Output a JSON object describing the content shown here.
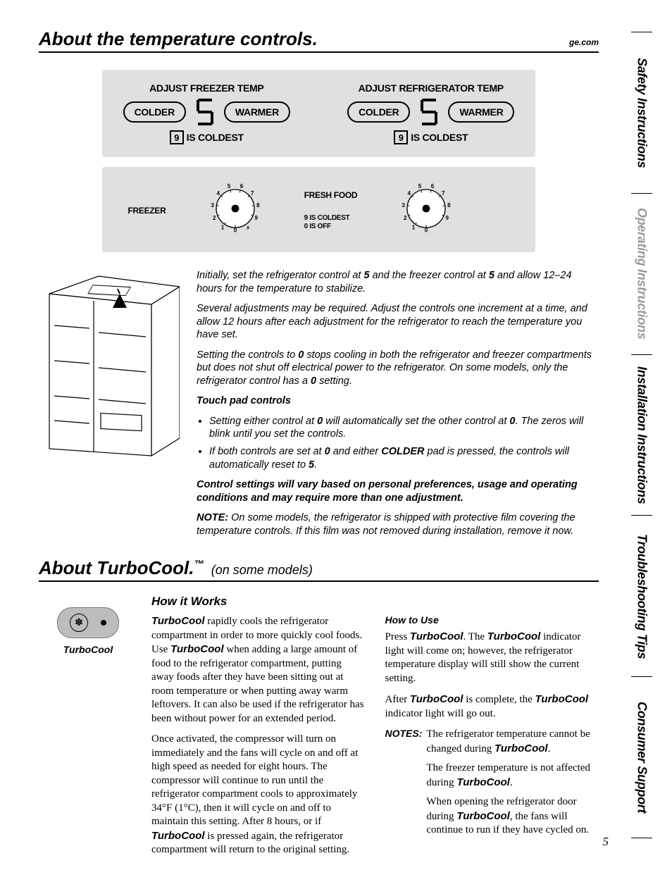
{
  "header": {
    "title": "About the temperature controls.",
    "site": "ge.com"
  },
  "sideTabs": {
    "t1": "Safety Instructions",
    "t2": "Operating Instructions",
    "t3": "Installation Instructions",
    "t4": "Troubleshooting Tips",
    "t5": "Consumer Support"
  },
  "digital": {
    "freezer": {
      "title": "ADJUST FREEZER TEMP",
      "colder": "COLDER",
      "warmer": "WARMER",
      "value": "5",
      "foot9": "9",
      "foot": "IS COLDEST"
    },
    "fridge": {
      "title": "ADJUST REFRIGERATOR TEMP",
      "colder": "COLDER",
      "warmer": "WARMER",
      "value": "5",
      "foot9": "9",
      "foot": "IS COLDEST"
    }
  },
  "dial": {
    "freezerLabel": "FREEZER",
    "freshLabel": "FRESH FOOD",
    "freshNote1": "9 IS COLDEST",
    "freshNote2": "0 IS OFF"
  },
  "instructions": {
    "p1a": "Initially, set the refrigerator control at ",
    "p1b": " and the freezer control at  ",
    "p1c": " and allow 12–24 hours for the temperature to stabilize.",
    "v5a": "5",
    "v5b": "5",
    "p2": "Several adjustments may be required. Adjust the controls one increment at a time, and allow 12 hours after each adjustment for the refrigerator to reach the temperature you have set.",
    "p3a": "Setting the controls to ",
    "p3b": " stops cooling in both the refrigerator and freezer compartments but does not shut off electrical power to the refrigerator. On some models, only the refrigerator control has a ",
    "p3c": " setting.",
    "v0a": "0",
    "v0b": "0",
    "touchTitle": "Touch pad controls",
    "li1a": "Setting either control at ",
    "li1b": " will automatically set the other control at ",
    "li1c": ". The zeros will blink until you set the controls.",
    "li1v0a": "0",
    "li1v0b": "0",
    "li2a": "If both controls are set at ",
    "li2b": " and either ",
    "li2c": " pad is pressed, the controls will automatically reset to ",
    "li2d": ".",
    "li2v0": "0",
    "li2colder": "COLDER",
    "li2v5": "5",
    "varyNote": "Control settings will vary based on personal preferences, usage and operating conditions and may require more than one adjustment.",
    "noteLabel": "NOTE:",
    "noteText": " On some models, the refrigerator is shipped with protective film covering the temperature controls. If this film was not removed during installation, remove it now."
  },
  "turbo": {
    "title": "About TurboCool.",
    "tm": "™",
    "sub": "(on some models)",
    "badge": "TurboCool",
    "howWorksTitle": "How it Works",
    "howUseTitle": "How to Use",
    "tc": "TurboCool",
    "hw1a": " rapidly cools the refrigerator compartment in order to more quickly cool foods. Use ",
    "hw1b": " when adding a large amount of food to the refrigerator compartment, putting away foods after they have been sitting out at room temperature or when putting away warm leftovers. It can also be used if the refrigerator has been without power for an extended period.",
    "hw2a": "Once activated, the compressor will turn on immediately and the fans will cycle on and off at high speed as needed for eight hours. The compressor will continue to run until the refrigerator compartment cools to approximately 34°F (1°C), then it will cycle on and off to maintain this setting. After 8 hours, or if ",
    "hw2b": " is pressed again, the refrigerator compartment will return to the original setting.",
    "hu1a": "Press ",
    "hu1b": ". The ",
    "hu1c": " indicator light will come on; however, the refrigerator temperature display will still show the current setting.",
    "hu2a": "After ",
    "hu2b": " is complete, the ",
    "hu2c": " indicator light will go out.",
    "notesLabel": "NOTES:",
    "n1a": "The refrigerator temperature cannot be changed during ",
    "n1b": ".",
    "n2a": "The freezer temperature is not affected during ",
    "n2b": ".",
    "n3a": "When opening the refrigerator door during ",
    "n3b": ", the fans will continue to run if they have cycled on."
  },
  "pageNum": "5"
}
